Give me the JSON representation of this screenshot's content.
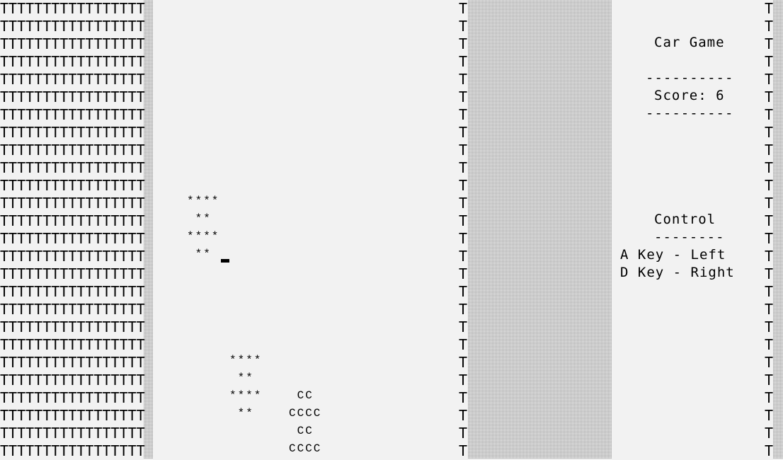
{
  "title": "Car Game",
  "sep_top": "----------",
  "score_label": "Score:",
  "score_value": "6",
  "sep_bottom": "----------",
  "controls": {
    "heading": "Control",
    "underline": "--------",
    "left": "A Key - Left",
    "right": "D Key - Right"
  },
  "left_border_row": "TTTTTTTTTTTTTTTTT",
  "border_glyph": "T",
  "enemy_car_sprite": "****\n ** \n****\n ** ",
  "player_car_sprite": " CC \nCCCC\n CC \nCCCC",
  "colors": {
    "background": "#f2f2f2",
    "shade": "#e9e9e9",
    "text": "#000000"
  }
}
